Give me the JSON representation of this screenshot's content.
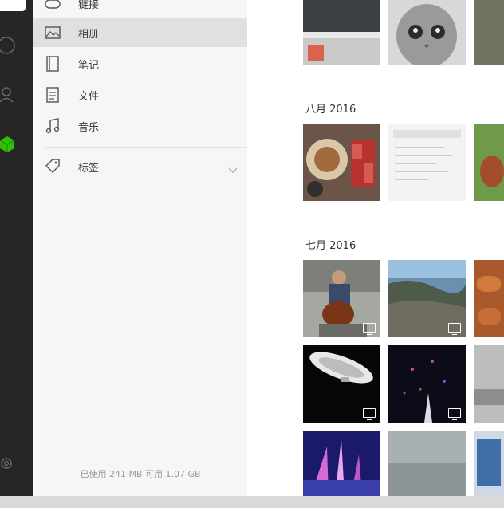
{
  "sidebar": {
    "items": [
      {
        "label": "链接",
        "icon": "link-icon"
      },
      {
        "label": "相册",
        "icon": "image-icon",
        "selected": true
      },
      {
        "label": "笔记",
        "icon": "notebook-icon"
      },
      {
        "label": "文件",
        "icon": "file-icon"
      },
      {
        "label": "音乐",
        "icon": "music-note-icon"
      }
    ],
    "tags": {
      "label": "标签",
      "icon": "tag-icon",
      "expand_icon": "chevron-down-icon"
    },
    "storage": "已使用 241 MB 可用 1.07 GB"
  },
  "rail": {
    "icons": [
      "avatar",
      "chat-icon",
      "contacts-icon",
      "favorites-cube-icon",
      "settings-gear-icon"
    ],
    "accent": "#2dc100"
  },
  "gallery": {
    "months": [
      {
        "label": "八月 2016"
      },
      {
        "label": "七月 2016"
      }
    ]
  },
  "colors": {
    "rail_bg": "#262626",
    "sidebar_bg": "#f6f6f6",
    "selected_bg": "#e0e0e0"
  }
}
